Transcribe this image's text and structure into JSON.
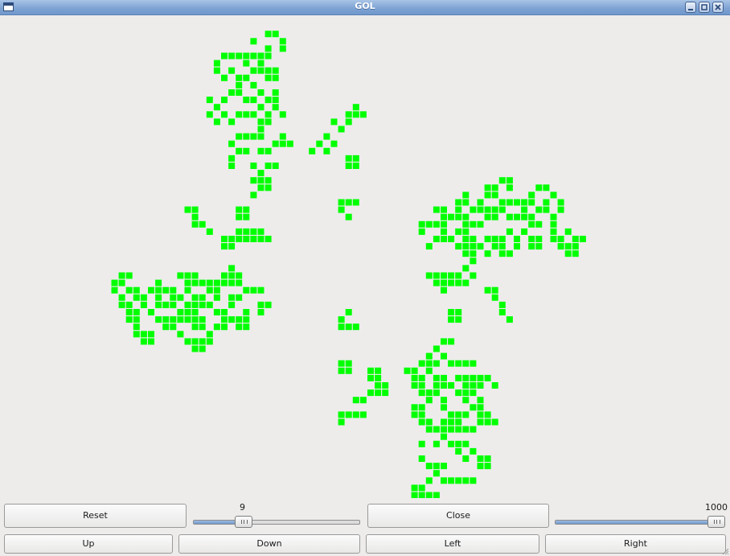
{
  "window": {
    "title": "GOL",
    "icons": [
      "app-icon",
      "minimize-icon",
      "maximize-icon",
      "close-icon"
    ]
  },
  "board": {
    "cell_color": "#00ff00",
    "background": "#edeceb",
    "live_cells": [
      [
        36,
        2
      ],
      [
        37,
        2
      ],
      [
        38,
        3
      ],
      [
        34,
        3
      ],
      [
        36,
        4
      ],
      [
        38,
        4
      ],
      [
        30,
        5
      ],
      [
        31,
        5
      ],
      [
        32,
        5
      ],
      [
        33,
        5
      ],
      [
        34,
        5
      ],
      [
        35,
        5
      ],
      [
        36,
        5
      ],
      [
        29,
        6
      ],
      [
        33,
        6
      ],
      [
        35,
        6
      ],
      [
        29,
        7
      ],
      [
        31,
        7
      ],
      [
        34,
        7
      ],
      [
        35,
        7
      ],
      [
        36,
        7
      ],
      [
        37,
        7
      ],
      [
        30,
        8
      ],
      [
        32,
        8
      ],
      [
        33,
        8
      ],
      [
        36,
        8
      ],
      [
        37,
        8
      ],
      [
        32,
        9
      ],
      [
        34,
        9
      ],
      [
        31,
        10
      ],
      [
        32,
        10
      ],
      [
        35,
        10
      ],
      [
        37,
        10
      ],
      [
        37,
        11
      ],
      [
        36,
        11
      ],
      [
        28,
        11
      ],
      [
        30,
        11
      ],
      [
        34,
        11
      ],
      [
        33,
        11
      ],
      [
        35,
        12
      ],
      [
        29,
        12
      ],
      [
        28,
        13
      ],
      [
        30,
        13
      ],
      [
        32,
        13
      ],
      [
        33,
        13
      ],
      [
        34,
        13
      ],
      [
        38,
        13
      ],
      [
        36,
        13
      ],
      [
        37,
        12
      ],
      [
        29,
        14
      ],
      [
        31,
        14
      ],
      [
        35,
        14
      ],
      [
        36,
        14
      ],
      [
        35,
        15
      ],
      [
        32,
        16
      ],
      [
        33,
        16
      ],
      [
        34,
        16
      ],
      [
        35,
        16
      ],
      [
        38,
        16
      ],
      [
        31,
        17
      ],
      [
        37,
        17
      ],
      [
        38,
        17
      ],
      [
        39,
        17
      ],
      [
        36,
        18
      ],
      [
        35,
        18
      ],
      [
        32,
        18
      ],
      [
        33,
        18
      ],
      [
        31,
        19
      ],
      [
        31,
        20
      ],
      [
        34,
        20
      ],
      [
        36,
        20
      ],
      [
        37,
        20
      ],
      [
        35,
        21
      ],
      [
        36,
        22
      ],
      [
        34,
        22
      ],
      [
        35,
        22
      ],
      [
        35,
        23
      ],
      [
        36,
        23
      ],
      [
        34,
        24
      ],
      [
        48,
        12
      ],
      [
        47,
        13
      ],
      [
        48,
        13
      ],
      [
        49,
        13
      ],
      [
        47,
        14
      ],
      [
        45,
        14
      ],
      [
        46,
        15
      ],
      [
        44,
        16
      ],
      [
        43,
        17
      ],
      [
        45,
        17
      ],
      [
        44,
        18
      ],
      [
        42,
        18
      ],
      [
        47,
        19
      ],
      [
        48,
        19
      ],
      [
        47,
        20
      ],
      [
        48,
        20
      ],
      [
        46,
        25
      ],
      [
        47,
        25
      ],
      [
        48,
        25
      ],
      [
        46,
        26
      ],
      [
        47,
        27
      ],
      [
        26,
        26
      ],
      [
        25,
        26
      ],
      [
        32,
        26
      ],
      [
        33,
        26
      ],
      [
        26,
        27
      ],
      [
        32,
        27
      ],
      [
        33,
        27
      ],
      [
        27,
        28
      ],
      [
        28,
        29
      ],
      [
        26,
        28
      ],
      [
        35,
        29
      ],
      [
        34,
        29
      ],
      [
        33,
        29
      ],
      [
        32,
        29
      ],
      [
        31,
        30
      ],
      [
        30,
        30
      ],
      [
        32,
        30
      ],
      [
        33,
        30
      ],
      [
        34,
        30
      ],
      [
        35,
        30
      ],
      [
        36,
        30
      ],
      [
        31,
        31
      ],
      [
        30,
        31
      ],
      [
        68,
        22
      ],
      [
        69,
        22
      ],
      [
        69,
        23
      ],
      [
        67,
        23
      ],
      [
        66,
        23
      ],
      [
        73,
        23
      ],
      [
        74,
        23
      ],
      [
        72,
        24
      ],
      [
        62,
        25
      ],
      [
        65,
        25
      ],
      [
        63,
        24
      ],
      [
        66,
        24
      ],
      [
        67,
        24
      ],
      [
        68,
        25
      ],
      [
        69,
        25
      ],
      [
        70,
        25
      ],
      [
        71,
        25
      ],
      [
        75,
        24
      ],
      [
        76,
        26
      ],
      [
        76,
        25
      ],
      [
        74,
        25
      ],
      [
        72,
        25
      ],
      [
        71,
        26
      ],
      [
        71,
        27
      ],
      [
        72,
        27
      ],
      [
        73,
        26
      ],
      [
        74,
        26
      ],
      [
        59,
        26
      ],
      [
        60,
        26
      ],
      [
        62,
        26
      ],
      [
        64,
        26
      ],
      [
        65,
        26
      ],
      [
        66,
        26
      ],
      [
        67,
        26
      ],
      [
        68,
        26
      ],
      [
        62,
        27
      ],
      [
        63,
        27
      ],
      [
        66,
        27
      ],
      [
        67,
        27
      ],
      [
        69,
        27
      ],
      [
        70,
        27
      ],
      [
        72,
        28
      ],
      [
        73,
        28
      ],
      [
        75,
        28
      ],
      [
        75,
        29
      ],
      [
        77,
        29
      ],
      [
        78,
        30
      ],
      [
        79,
        30
      ],
      [
        77,
        31
      ],
      [
        78,
        32
      ],
      [
        78,
        31
      ],
      [
        60,
        27
      ],
      [
        58,
        28
      ],
      [
        59,
        28
      ],
      [
        60,
        28
      ],
      [
        64,
        28
      ],
      [
        62,
        29
      ],
      [
        63,
        29
      ],
      [
        59,
        30
      ],
      [
        60,
        30
      ],
      [
        61,
        30
      ],
      [
        63,
        30
      ],
      [
        64,
        30
      ],
      [
        66,
        30
      ],
      [
        67,
        30
      ],
      [
        68,
        30
      ],
      [
        70,
        30
      ],
      [
        72,
        30
      ],
      [
        73,
        30
      ],
      [
        75,
        30
      ],
      [
        76,
        30
      ],
      [
        69,
        29
      ],
      [
        62,
        31
      ],
      [
        63,
        31
      ],
      [
        64,
        31
      ],
      [
        65,
        31
      ],
      [
        67,
        31
      ],
      [
        68,
        31
      ],
      [
        70,
        31
      ],
      [
        72,
        31
      ],
      [
        73,
        31
      ],
      [
        76,
        31
      ],
      [
        63,
        32
      ],
      [
        64,
        32
      ],
      [
        66,
        32
      ],
      [
        68,
        32
      ],
      [
        69,
        32
      ],
      [
        70,
        31
      ],
      [
        71,
        29
      ],
      [
        60,
        29
      ],
      [
        64,
        33
      ],
      [
        63,
        32
      ],
      [
        69,
        32
      ],
      [
        68,
        31
      ],
      [
        77,
        32
      ],
      [
        63,
        28
      ],
      [
        61,
        27
      ],
      [
        65,
        28
      ],
      [
        57,
        28
      ],
      [
        58,
        31
      ],
      [
        57,
        29
      ],
      [
        63,
        25
      ],
      [
        75,
        27
      ],
      [
        16,
        35
      ],
      [
        17,
        35
      ],
      [
        31,
        34
      ],
      [
        32,
        35
      ],
      [
        31,
        35
      ],
      [
        30,
        35
      ],
      [
        26,
        35
      ],
      [
        25,
        35
      ],
      [
        24,
        35
      ],
      [
        16,
        36
      ],
      [
        15,
        37
      ],
      [
        17,
        37
      ],
      [
        20,
        37
      ],
      [
        21,
        37
      ],
      [
        23,
        37
      ],
      [
        25,
        36
      ],
      [
        26,
        36
      ],
      [
        28,
        36
      ],
      [
        29,
        36
      ],
      [
        31,
        36
      ],
      [
        30,
        36
      ],
      [
        32,
        36
      ],
      [
        33,
        37
      ],
      [
        34,
        37
      ],
      [
        35,
        37
      ],
      [
        32,
        38
      ],
      [
        31,
        38
      ],
      [
        29,
        38
      ],
      [
        27,
        38
      ],
      [
        26,
        38
      ],
      [
        24,
        38
      ],
      [
        22,
        37
      ],
      [
        21,
        36
      ],
      [
        16,
        38
      ],
      [
        18,
        38
      ],
      [
        19,
        38
      ],
      [
        21,
        38
      ],
      [
        23,
        38
      ],
      [
        25,
        37
      ],
      [
        28,
        37
      ],
      [
        29,
        37
      ],
      [
        27,
        36
      ],
      [
        18,
        37
      ],
      [
        15,
        36
      ],
      [
        17,
        39
      ],
      [
        19,
        39
      ],
      [
        21,
        39
      ],
      [
        22,
        39
      ],
      [
        23,
        39
      ],
      [
        25,
        39
      ],
      [
        28,
        39
      ],
      [
        31,
        39
      ],
      [
        35,
        39
      ],
      [
        36,
        39
      ],
      [
        35,
        40
      ],
      [
        33,
        40
      ],
      [
        30,
        40
      ],
      [
        27,
        39
      ],
      [
        26,
        39
      ],
      [
        18,
        40
      ],
      [
        20,
        40
      ],
      [
        32,
        41
      ],
      [
        33,
        41
      ],
      [
        31,
        41
      ],
      [
        30,
        41
      ],
      [
        29,
        40
      ],
      [
        25,
        40
      ],
      [
        18,
        41
      ],
      [
        21,
        41
      ],
      [
        22,
        41
      ],
      [
        23,
        41
      ],
      [
        25,
        41
      ],
      [
        26,
        41
      ],
      [
        27,
        41
      ],
      [
        24,
        41
      ],
      [
        17,
        41
      ],
      [
        18,
        42
      ],
      [
        22,
        42
      ],
      [
        23,
        42
      ],
      [
        26,
        42
      ],
      [
        27,
        42
      ],
      [
        29,
        42
      ],
      [
        30,
        42
      ],
      [
        32,
        42
      ],
      [
        33,
        42
      ],
      [
        19,
        43
      ],
      [
        20,
        43
      ],
      [
        24,
        43
      ],
      [
        19,
        44
      ],
      [
        20,
        44
      ],
      [
        26,
        44
      ],
      [
        27,
        44
      ],
      [
        28,
        44
      ],
      [
        25,
        44
      ],
      [
        26,
        45
      ],
      [
        27,
        45
      ],
      [
        18,
        43
      ],
      [
        28,
        43
      ],
      [
        16,
        39
      ],
      [
        17,
        40
      ],
      [
        26,
        40
      ],
      [
        24,
        40
      ],
      [
        58,
        35
      ],
      [
        59,
        35
      ],
      [
        60,
        35
      ],
      [
        61,
        35
      ],
      [
        62,
        35
      ],
      [
        63,
        34
      ],
      [
        63,
        36
      ],
      [
        62,
        36
      ],
      [
        61,
        36
      ],
      [
        60,
        36
      ],
      [
        59,
        36
      ],
      [
        64,
        35
      ],
      [
        60,
        37
      ],
      [
        66,
        37
      ],
      [
        67,
        37
      ],
      [
        67,
        38
      ],
      [
        68,
        39
      ],
      [
        68,
        40
      ],
      [
        69,
        41
      ],
      [
        47,
        40
      ],
      [
        46,
        41
      ],
      [
        47,
        42
      ],
      [
        48,
        42
      ],
      [
        46,
        42
      ],
      [
        61,
        40
      ],
      [
        62,
        40
      ],
      [
        61,
        41
      ],
      [
        62,
        41
      ],
      [
        60,
        44
      ],
      [
        61,
        44
      ],
      [
        59,
        45
      ],
      [
        58,
        46
      ],
      [
        60,
        46
      ],
      [
        59,
        47
      ],
      [
        58,
        47
      ],
      [
        57,
        47
      ],
      [
        61,
        47
      ],
      [
        62,
        47
      ],
      [
        63,
        47
      ],
      [
        64,
        47
      ],
      [
        46,
        47
      ],
      [
        47,
        47
      ],
      [
        47,
        48
      ],
      [
        46,
        48
      ],
      [
        50,
        48
      ],
      [
        51,
        48
      ],
      [
        51,
        49
      ],
      [
        50,
        49
      ],
      [
        56,
        48
      ],
      [
        55,
        48
      ],
      [
        58,
        48
      ],
      [
        59,
        49
      ],
      [
        60,
        49
      ],
      [
        62,
        49
      ],
      [
        63,
        49
      ],
      [
        64,
        49
      ],
      [
        65,
        49
      ],
      [
        66,
        49
      ],
      [
        61,
        50
      ],
      [
        63,
        50
      ],
      [
        64,
        50
      ],
      [
        67,
        50
      ],
      [
        56,
        49
      ],
      [
        57,
        49
      ],
      [
        57,
        50
      ],
      [
        56,
        50
      ],
      [
        59,
        50
      ],
      [
        60,
        50
      ],
      [
        65,
        50
      ],
      [
        59,
        51
      ],
      [
        62,
        51
      ],
      [
        63,
        51
      ],
      [
        64,
        51
      ],
      [
        63,
        52
      ],
      [
        65,
        52
      ],
      [
        51,
        50
      ],
      [
        52,
        50
      ],
      [
        50,
        51
      ],
      [
        51,
        51
      ],
      [
        52,
        51
      ],
      [
        49,
        52
      ],
      [
        48,
        52
      ],
      [
        57,
        51
      ],
      [
        58,
        51
      ],
      [
        58,
        52
      ],
      [
        60,
        52
      ],
      [
        64,
        53
      ],
      [
        65,
        53
      ],
      [
        63,
        54
      ],
      [
        62,
        54
      ],
      [
        61,
        54
      ],
      [
        60,
        53
      ],
      [
        57,
        53
      ],
      [
        56,
        53
      ],
      [
        56,
        54
      ],
      [
        57,
        54
      ],
      [
        47,
        54
      ],
      [
        48,
        54
      ],
      [
        49,
        54
      ],
      [
        46,
        54
      ],
      [
        46,
        55
      ],
      [
        57,
        55
      ],
      [
        58,
        55
      ],
      [
        59,
        56
      ],
      [
        60,
        55
      ],
      [
        61,
        55
      ],
      [
        62,
        55
      ],
      [
        63,
        56
      ],
      [
        64,
        56
      ],
      [
        65,
        55
      ],
      [
        66,
        55
      ],
      [
        67,
        55
      ],
      [
        66,
        54
      ],
      [
        65,
        54
      ],
      [
        58,
        56
      ],
      [
        60,
        56
      ],
      [
        61,
        56
      ],
      [
        62,
        56
      ],
      [
        60,
        57
      ],
      [
        57,
        58
      ],
      [
        59,
        58
      ],
      [
        61,
        58
      ],
      [
        62,
        58
      ],
      [
        63,
        58
      ],
      [
        62,
        59
      ],
      [
        64,
        59
      ],
      [
        63,
        60
      ],
      [
        65,
        60
      ],
      [
        66,
        60
      ],
      [
        65,
        61
      ],
      [
        66,
        61
      ],
      [
        60,
        61
      ],
      [
        59,
        61
      ],
      [
        58,
        61
      ],
      [
        57,
        60
      ],
      [
        59,
        62
      ],
      [
        60,
        63
      ],
      [
        61,
        63
      ],
      [
        62,
        63
      ],
      [
        63,
        63
      ],
      [
        64,
        63
      ],
      [
        58,
        63
      ],
      [
        57,
        64
      ],
      [
        56,
        64
      ],
      [
        58,
        65
      ],
      [
        59,
        65
      ],
      [
        57,
        65
      ],
      [
        56,
        65
      ],
      [
        56,
        66
      ],
      [
        57,
        66
      ],
      [
        58,
        66
      ],
      [
        59,
        66
      ]
    ]
  },
  "controls": {
    "reset_label": "Reset",
    "close_label": "Close",
    "up_label": "Up",
    "down_label": "Down",
    "left_label": "Left",
    "right_label": "Right",
    "speed_slider": {
      "value": "9",
      "fraction": 0.28
    },
    "delay_slider": {
      "value": "1000",
      "fraction": 1.0
    }
  }
}
